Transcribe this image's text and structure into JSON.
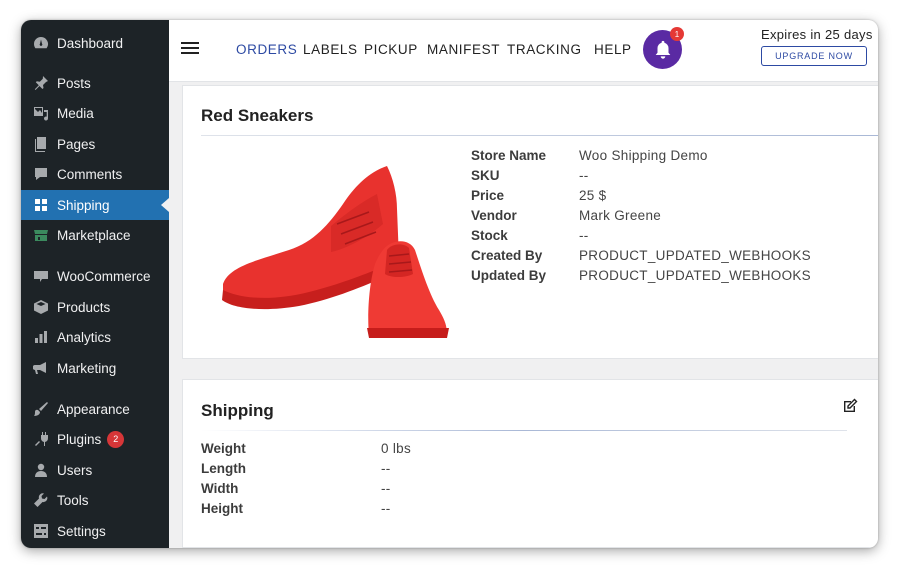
{
  "sidebar": {
    "items": [
      {
        "label": "Dashboard",
        "icon": "dashboard-icon"
      },
      {
        "label": "Posts",
        "icon": "pin-icon"
      },
      {
        "label": "Media",
        "icon": "media-icon"
      },
      {
        "label": "Pages",
        "icon": "pages-icon"
      },
      {
        "label": "Comments",
        "icon": "comment-icon"
      },
      {
        "label": "Shipping",
        "icon": "grid-icon",
        "active": true
      },
      {
        "label": "Marketplace",
        "icon": "store-icon"
      },
      {
        "label": "WooCommerce",
        "icon": "woo-icon"
      },
      {
        "label": "Products",
        "icon": "box-icon"
      },
      {
        "label": "Analytics",
        "icon": "bar-chart-icon"
      },
      {
        "label": "Marketing",
        "icon": "megaphone-icon"
      },
      {
        "label": "Appearance",
        "icon": "brush-icon"
      },
      {
        "label": "Plugins",
        "icon": "plug-icon",
        "badge": "2"
      },
      {
        "label": "Users",
        "icon": "user-icon"
      },
      {
        "label": "Tools",
        "icon": "wrench-icon"
      },
      {
        "label": "Settings",
        "icon": "settings-icon"
      }
    ]
  },
  "topbar": {
    "nav": [
      "ORDERS",
      "LABELS",
      "PICKUP",
      "MANIFEST",
      "TRACKING",
      "HELP"
    ],
    "active_nav": "ORDERS",
    "notification_count": "1",
    "expires_text": "Expires in 25 days",
    "upgrade_label": "UPGRADE NOW"
  },
  "product": {
    "title": "Red Sneakers",
    "details": [
      {
        "label": "Store Name",
        "value": "Woo Shipping Demo"
      },
      {
        "label": "SKU",
        "value": "--"
      },
      {
        "label": "Price",
        "value": "25 $"
      },
      {
        "label": "Vendor",
        "value": "Mark Greene"
      },
      {
        "label": "Stock",
        "value": "--"
      },
      {
        "label": "Created By",
        "value": "PRODUCT_UPDATED_WEBHOOKS"
      },
      {
        "label": "Updated By",
        "value": "PRODUCT_UPDATED_WEBHOOKS"
      }
    ]
  },
  "shipping": {
    "title": "Shipping",
    "details": [
      {
        "label": "Weight",
        "value": "0 lbs"
      },
      {
        "label": "Length",
        "value": "--"
      },
      {
        "label": "Width",
        "value": "--"
      },
      {
        "label": "Height",
        "value": "--"
      }
    ]
  },
  "colors": {
    "sidebar_bg": "#1d2327",
    "active_blue": "#2271b1",
    "nav_active": "#2d4aa3",
    "bell_purple": "#5a2aa3",
    "badge_red": "#d63638"
  }
}
